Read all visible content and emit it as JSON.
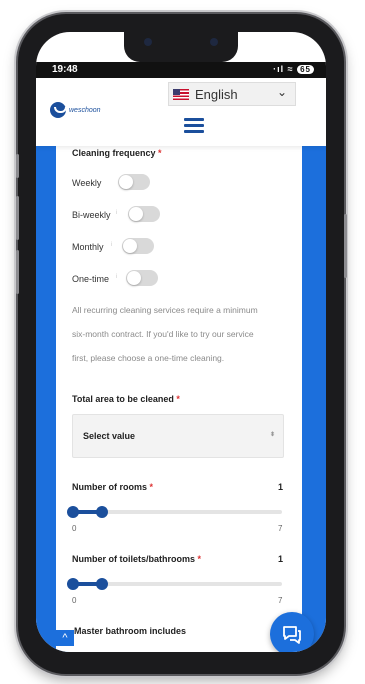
{
  "status": {
    "time": "19:48",
    "icons": "·ıl ≈",
    "battery": "65"
  },
  "header": {
    "logo_text": "weschoon",
    "language": "English"
  },
  "form": {
    "frequency_label": "Cleaning frequency",
    "req": "*",
    "frequency_options": [
      {
        "label": "Weekly",
        "on": false
      },
      {
        "label": "Bi-weekly",
        "on": false
      },
      {
        "label": "Monthly",
        "on": false
      },
      {
        "label": "One-time",
        "on": false
      }
    ],
    "tiny_mark": "i",
    "note_lines": [
      "All recurring cleaning services require a minimum",
      "six-month contract. If you'd like to try our service",
      "first, please choose a one-time cleaning."
    ],
    "area_label": "Total area to be cleaned",
    "area_value": "Select value",
    "rooms_label": "Number of rooms",
    "rooms_value": "1",
    "rooms_min": "0",
    "rooms_max": "7",
    "rooms_level": 0.143,
    "toilets_label": "Number of toilets/bathrooms",
    "toilets_value": "1",
    "toilets_min": "0",
    "toilets_max": "7",
    "toilets_level": 0.143,
    "master_label": "Master bathroom includes"
  },
  "icons": {
    "up_arrow": "^",
    "chat": "chat-bubble-icon",
    "dropdown": "⬍",
    "chevron": "⌄"
  },
  "colors": {
    "accent": "#1c6fdc",
    "brand": "#1b4f9c"
  }
}
